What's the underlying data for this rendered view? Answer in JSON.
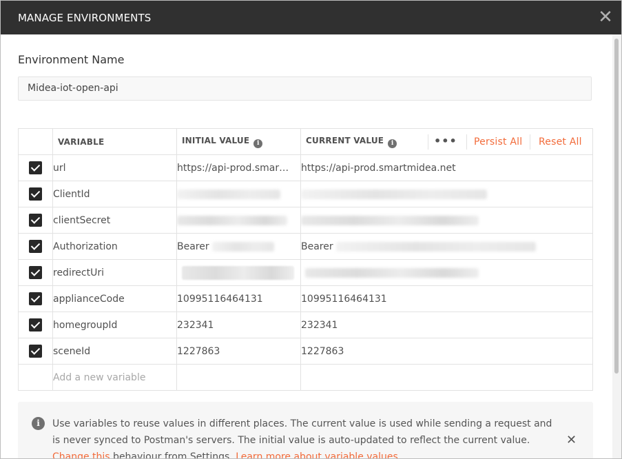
{
  "modal": {
    "title": "MANAGE ENVIRONMENTS",
    "close_icon": "close-icon"
  },
  "environment": {
    "label": "Environment Name",
    "name": "Midea-iot-open-api"
  },
  "table": {
    "headers": {
      "variable": "VARIABLE",
      "initial_value": "INITIAL VALUE",
      "current_value": "CURRENT VALUE"
    },
    "actions": {
      "more": "•••",
      "persist_all": "Persist All",
      "reset_all": "Reset All"
    },
    "rows": [
      {
        "checked": true,
        "variable": "url",
        "initial": "https://api-prod.smar…",
        "current": "https://api-prod.smartmidea.net"
      },
      {
        "checked": true,
        "variable": "ClientId",
        "initial": "",
        "current": ""
      },
      {
        "checked": true,
        "variable": "clientSecret",
        "initial": "",
        "current": ""
      },
      {
        "checked": true,
        "variable": "Authorization",
        "initial": "Bearer",
        "current": "Bearer"
      },
      {
        "checked": true,
        "variable": "redirectUri",
        "initial": "",
        "current": ""
      },
      {
        "checked": true,
        "variable": "applianceCode",
        "initial": "10995116464131",
        "current": "10995116464131"
      },
      {
        "checked": true,
        "variable": "homegroupId",
        "initial": "232341",
        "current": "232341"
      },
      {
        "checked": true,
        "variable": "sceneId",
        "initial": "1227863",
        "current": "1227863"
      }
    ],
    "add_placeholder": "Add a new variable"
  },
  "notice": {
    "line1": "Use variables to reuse values in different places. The current value is used while sending a request and",
    "line2": "is never synced to Postman's servers. The initial value is auto-updated to reflect the current value.",
    "link1": "Change this",
    "line3_mid": " behaviour from Settings. ",
    "link2": "Learn more about variable values"
  },
  "colors": {
    "header_bg": "#303030",
    "accent": "#f26b3a",
    "checkbox": "#282828"
  }
}
